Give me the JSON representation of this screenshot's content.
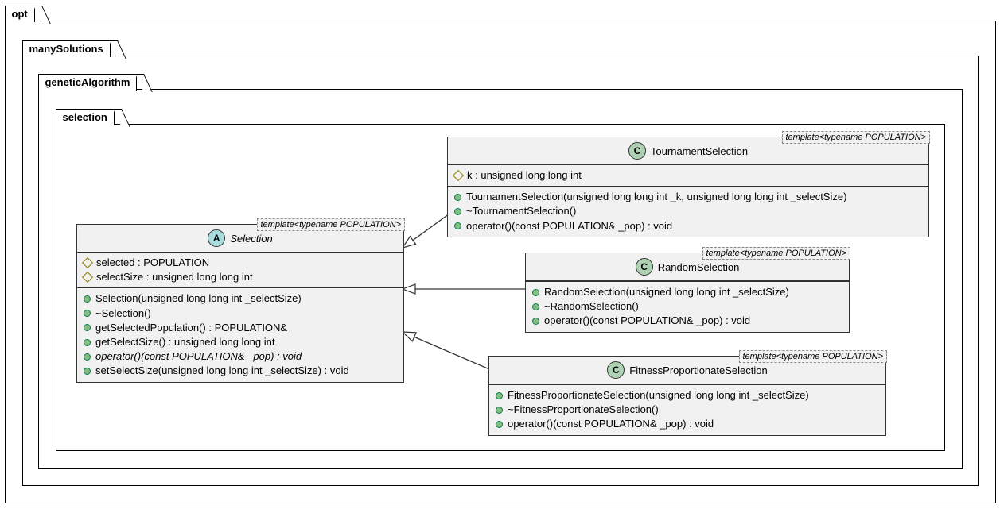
{
  "packages": {
    "opt": "opt",
    "manySolutions": "manySolutions",
    "geneticAlgorithm": "geneticAlgorithm",
    "selection": "selection"
  },
  "templateParam": "template<typename POPULATION>",
  "selectionClass": {
    "name": "Selection",
    "attrs": {
      "selected": "selected : POPULATION",
      "selectSize": "selectSize : unsigned long long int"
    },
    "ops": {
      "ctor": "Selection(unsigned long long int _selectSize)",
      "dtor": "~Selection()",
      "getSelectedPopulation": "getSelectedPopulation() : POPULATION&",
      "getSelectSize": "getSelectSize() : unsigned long long int",
      "operatorCall": "operator()(const POPULATION& _pop) : void",
      "setSelectSize": "setSelectSize(unsigned long long int _selectSize) : void"
    }
  },
  "tournament": {
    "name": "TournamentSelection",
    "attrs": {
      "k": "k : unsigned long long int"
    },
    "ops": {
      "ctor": "TournamentSelection(unsigned long long int _k, unsigned long long int _selectSize)",
      "dtor": "~TournamentSelection()",
      "operatorCall": "operator()(const POPULATION& _pop) : void"
    }
  },
  "random": {
    "name": "RandomSelection",
    "ops": {
      "ctor": "RandomSelection(unsigned long long int _selectSize)",
      "dtor": "~RandomSelection()",
      "operatorCall": "operator()(const POPULATION& _pop) : void"
    }
  },
  "fitness": {
    "name": "FitnessProportionateSelection",
    "ops": {
      "ctor": "FitnessProportionateSelection(unsigned long long int _selectSize)",
      "dtor": "~FitnessProportionateSelection()",
      "operatorCall": "operator()(const POPULATION& _pop) : void"
    }
  }
}
